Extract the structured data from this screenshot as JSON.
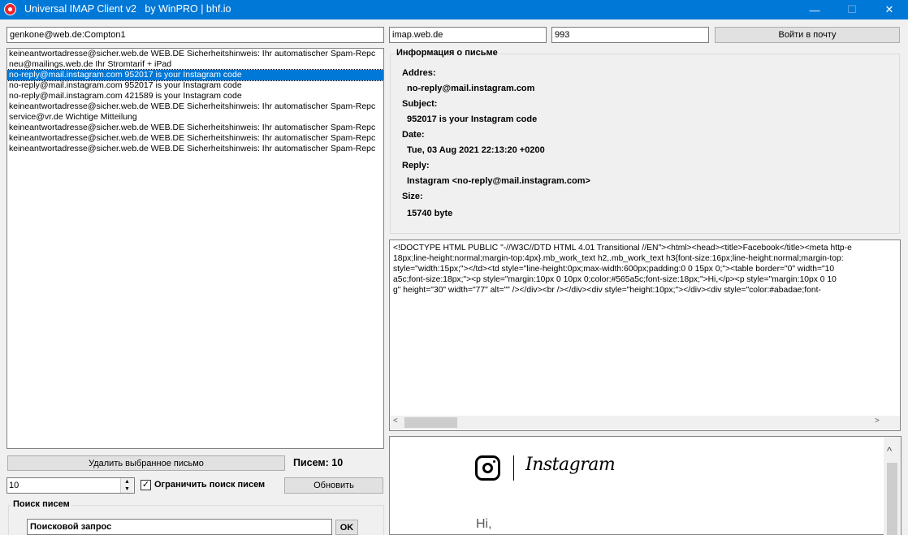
{
  "window": {
    "title": "Universal IMAP Client v2   by WinPRO | bhf.io",
    "minimize": "—",
    "maximize": "☐",
    "close": "✕"
  },
  "login": {
    "account": "genkone@web.de:Compton1",
    "server": "imap.web.de",
    "port": "993",
    "login_button": "Войти в почту"
  },
  "mail_list": {
    "items": [
      "keineantwortadresse@sicher.web.de WEB.DE Sicherheitshinweis: Ihr automatischer Spam-Repc",
      "neu@mailings.web.de Ihr Stromtarif + iPad",
      "no-reply@mail.instagram.com 952017 is your Instagram code",
      "no-reply@mail.instagram.com 952017 is your Instagram code",
      "no-reply@mail.instagram.com 421589 is your Instagram code",
      "keineantwortadresse@sicher.web.de WEB.DE Sicherheitshinweis: Ihr automatischer Spam-Repc",
      "service@vr.de Wichtige Mitteilung",
      "keineantwortadresse@sicher.web.de WEB.DE Sicherheitshinweis: Ihr automatischer Spam-Repc",
      "keineantwortadresse@sicher.web.de WEB.DE Sicherheitshinweis: Ihr automatischer Spam-Repc",
      "keineantwortadresse@sicher.web.de WEB.DE Sicherheitshinweis: Ihr automatischer Spam-Repc"
    ],
    "selected_index": 2
  },
  "actions": {
    "delete_button": "Удалить выбранное письмо",
    "count_label": "Писем: 10",
    "limit_value": "10",
    "limit_checkbox_label": "Ограничить поиск писем",
    "limit_checked": true,
    "refresh_button": "Обновить"
  },
  "search": {
    "legend": "Поиск писем",
    "query": "Поисковой запрос",
    "ok_button": "OK"
  },
  "info": {
    "legend": "Информация о письме",
    "address_label": "Addres:",
    "address": "no-reply@mail.instagram.com",
    "subject_label": "Subject:",
    "subject": "952017 is your Instagram code",
    "date_label": "Date:",
    "date": "Tue, 03 Aug 2021 22:13:20 +0200",
    "reply_label": "Reply:",
    "reply": "Instagram <no-reply@mail.instagram.com>",
    "size_label": "Size:",
    "size": "15740 byte"
  },
  "source": {
    "lines": [
      "<!DOCTYPE HTML PUBLIC \"-//W3C//DTD HTML 4.01 Transitional //EN\"><html><head><title>Facebook</title><meta http-e",
      "18px;line-height:normal;margin-top:4px}.mb_work_text h2,.mb_work_text h3{font-size:16px;line-height:normal;margin-top:",
      "style=\"width:15px;\"></td><td style=\"line-height:0px;max-width:600px;padding:0 0 15px 0;\"><table border=\"0\" width=\"10",
      "a5c;font-size:18px;\"><p style=\"margin:10px 0 10px 0;color:#565a5c;font-size:18px;\">Hi,</p><p style=\"margin:10px 0 10",
      "g\" height=\"30\" width=\"77\" alt=\"\" /></div><br /></div><div style=\"height:10px;\"></div><div style=\"color:#abadae;font-"
    ],
    "scroll_left": "<",
    "scroll_right": ">"
  },
  "preview": {
    "brand": "Instagram",
    "greeting": "Hi,",
    "scroll_up": "^",
    "icon": "instagram-logo-icon"
  }
}
